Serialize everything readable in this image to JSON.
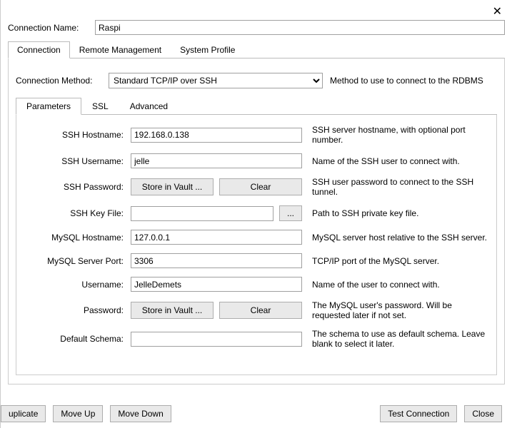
{
  "close": "✕",
  "connName": {
    "label": "Connection Name:",
    "value": "Raspi"
  },
  "topTabs": {
    "connection": "Connection",
    "remote": "Remote Management",
    "system": "System Profile"
  },
  "method": {
    "label": "Connection Method:",
    "selected": "Standard TCP/IP over SSH",
    "help": "Method to use to connect to the RDBMS"
  },
  "subTabs": {
    "parameters": "Parameters",
    "ssl": "SSL",
    "advanced": "Advanced"
  },
  "params": {
    "sshHost": {
      "label": "SSH Hostname:",
      "value": "192.168.0.138",
      "help": "SSH server hostname, with  optional port number."
    },
    "sshUser": {
      "label": "SSH Username:",
      "value": "jelle",
      "help": "Name of the SSH user to connect with."
    },
    "sshPass": {
      "label": "SSH Password:",
      "store": "Store in Vault ...",
      "clear": "Clear",
      "help": "SSH user password to connect to the SSH tunnel."
    },
    "sshKey": {
      "label": "SSH Key File:",
      "value": "",
      "browse": "...",
      "help": "Path to SSH private key file."
    },
    "myHost": {
      "label": "MySQL Hostname:",
      "value": "127.0.0.1",
      "help": "MySQL server host relative to the SSH server."
    },
    "myPort": {
      "label": "MySQL Server Port:",
      "value": "3306",
      "help": "TCP/IP port of the MySQL server."
    },
    "username": {
      "label": "Username:",
      "value": "JelleDemets",
      "help": "Name of the user to connect with."
    },
    "password": {
      "label": "Password:",
      "store": "Store in Vault ...",
      "clear": "Clear",
      "help": "The MySQL user's password. Will be requested later if not set."
    },
    "schema": {
      "label": "Default Schema:",
      "value": "",
      "help": "The schema to use as default schema. Leave blank to select it later."
    }
  },
  "footer": {
    "duplicate": "uplicate",
    "moveUp": "Move Up",
    "moveDown": "Move Down",
    "test": "Test Connection",
    "close": "Close"
  }
}
